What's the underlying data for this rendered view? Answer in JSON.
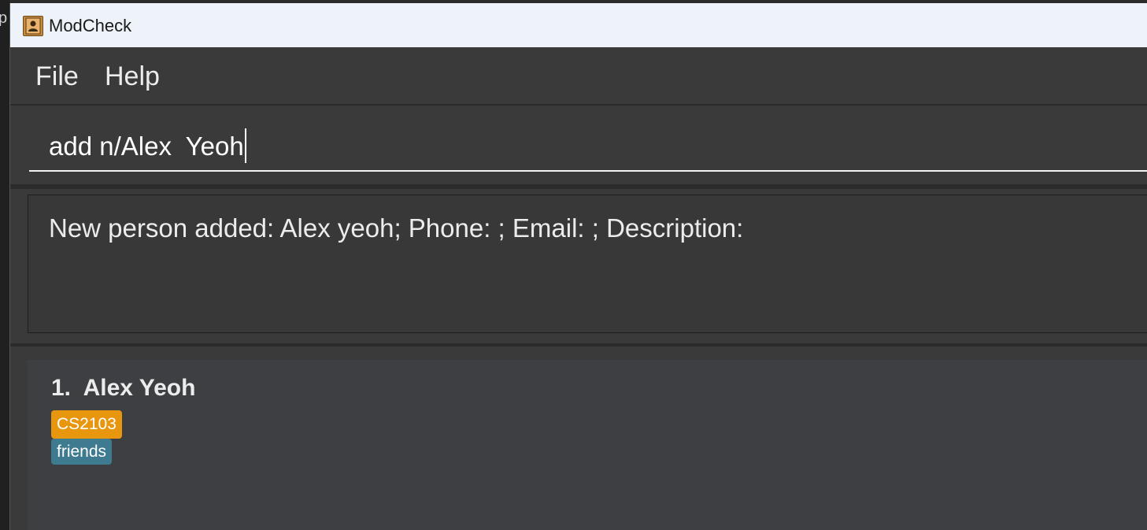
{
  "window": {
    "title": "ModCheck"
  },
  "desktop": {
    "edge_glyph": "p"
  },
  "menu": {
    "items": [
      {
        "label": "File"
      },
      {
        "label": "Help"
      }
    ]
  },
  "command_box": {
    "value": "add n/Alex  Yeoh"
  },
  "result_display": {
    "text": "New person added: Alex yeoh; Phone: ; Email: ; Description:"
  },
  "person_list": {
    "items": [
      {
        "index": "1.",
        "name": "Alex Yeoh",
        "tags": [
          {
            "label": "CS2103",
            "color": "#e8960d"
          },
          {
            "label": "friends",
            "color": "#3e7b91"
          }
        ]
      }
    ]
  },
  "colors": {
    "titlebar": "#eef3f9",
    "window_bg": "#3a3a3a",
    "separator": "#2b2b2b",
    "text": "#ececec"
  }
}
